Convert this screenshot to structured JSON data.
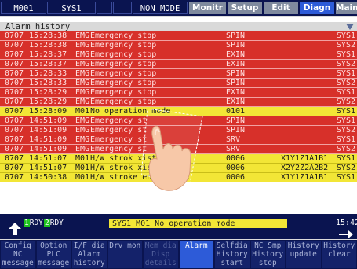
{
  "topbar": {
    "part": "M001",
    "system": "SYS1",
    "mode": "NON MODE",
    "tabs": [
      {
        "label": "Monitr",
        "active": false
      },
      {
        "label": "Setup",
        "active": false
      },
      {
        "label": "Edit",
        "active": false
      },
      {
        "label": "Diagn",
        "active": true
      },
      {
        "label": "Mainte",
        "active": false
      }
    ]
  },
  "alarm_history": {
    "title": "Alarm history",
    "rows": [
      {
        "date": "0707",
        "time": "15:28:38",
        "type": "EMG",
        "message": "Emergency stop",
        "code": "SPIN",
        "axis": "",
        "system": "SYS1",
        "color": "red"
      },
      {
        "date": "0707",
        "time": "15:28:38",
        "type": "EMG",
        "message": "Emergency stop",
        "code": "SPIN",
        "axis": "",
        "system": "SYS2",
        "color": "red"
      },
      {
        "date": "0707",
        "time": "15:28:37",
        "type": "EMG",
        "message": "Emergency stop",
        "code": "EXIN",
        "axis": "",
        "system": "SYS1",
        "color": "red"
      },
      {
        "date": "0707",
        "time": "15:28:37",
        "type": "EMG",
        "message": "Emergency stop",
        "code": "EXIN",
        "axis": "",
        "system": "SYS2",
        "color": "red"
      },
      {
        "date": "0707",
        "time": "15:28:33",
        "type": "EMG",
        "message": "Emergency stop",
        "code": "SPIN",
        "axis": "",
        "system": "SYS1",
        "color": "red"
      },
      {
        "date": "0707",
        "time": "15:28:33",
        "type": "EMG",
        "message": "Emergency stop",
        "code": "SPIN",
        "axis": "",
        "system": "SYS2",
        "color": "red"
      },
      {
        "date": "0707",
        "time": "15:28:29",
        "type": "EMG",
        "message": "Emergency stop",
        "code": "EXIN",
        "axis": "",
        "system": "SYS1",
        "color": "red"
      },
      {
        "date": "0707",
        "time": "15:28:29",
        "type": "EMG",
        "message": "Emergency stop",
        "code": "EXIN",
        "axis": "",
        "system": "SYS2",
        "color": "red"
      },
      {
        "date": "0707",
        "time": "15:28:09",
        "type": "M01",
        "message": "No operation mode",
        "code": "0101",
        "axis": "",
        "system": "SYS1",
        "color": "yellow"
      },
      {
        "date": "0707",
        "time": "14:51:09",
        "type": "EMG",
        "message": "Emergency st",
        "code": "SPIN",
        "axis": "",
        "system": "SYS1",
        "color": "red"
      },
      {
        "date": "0707",
        "time": "14:51:09",
        "type": "EMG",
        "message": "Emergency st",
        "code": "SPIN",
        "axis": "",
        "system": "SYS2",
        "color": "red"
      },
      {
        "date": "0707",
        "time": "14:51:09",
        "type": "EMG",
        "message": "Emergency st",
        "code": "SRV",
        "axis": "",
        "system": "SYS1",
        "color": "red"
      },
      {
        "date": "0707",
        "time": "14:51:09",
        "type": "EMG",
        "message": "Emergency st",
        "code": "SRV",
        "axis": "",
        "system": "SYS2",
        "color": "red"
      },
      {
        "date": "0707",
        "time": "14:51:07",
        "type": "M01",
        "message": "H/W strok        xists",
        "code": "0006",
        "axis": "X1Y1Z1A1B1",
        "system": "SYS1",
        "color": "yellow"
      },
      {
        "date": "0707",
        "time": "14:51:07",
        "type": "M01",
        "message": "H/W strok        xists",
        "code": "0006",
        "axis": "X2Y2Z2A2B2",
        "system": "SYS2",
        "color": "yellow"
      },
      {
        "date": "0707",
        "time": "14:50:38",
        "type": "M01",
        "message": "H/W stroke end    exists",
        "code": "0006",
        "axis": "X1Y1Z1A1B1",
        "system": "SYS1",
        "color": "yellow"
      }
    ]
  },
  "statusbar": {
    "rdy1_num": "1",
    "rdy1_label": "RDY",
    "rdy2_num": "2",
    "rdy2_label": "RDY",
    "message": "SYS1 M01  No operation mode",
    "clock": "15:42"
  },
  "function_keys": [
    {
      "top": "Config",
      "bottom": "NC",
      "third": "message",
      "state": "normal"
    },
    {
      "top": "Option",
      "bottom": "PLC",
      "third": "message",
      "state": "normal"
    },
    {
      "top": "I/F dia",
      "bottom": "Alarm",
      "third": "history",
      "state": "normal"
    },
    {
      "top": "Drv mon",
      "bottom": "",
      "third": "",
      "state": "normal"
    },
    {
      "top": "Mem dia",
      "bottom": "Disp",
      "third": "details",
      "state": "normal"
    },
    {
      "top": "Alarm",
      "bottom": "",
      "third": "",
      "state": "on"
    },
    {
      "top": "Selfdia",
      "bottom": "History",
      "third": "start",
      "state": "normal"
    },
    {
      "top": "NC Smp",
      "bottom": "History",
      "third": "stop",
      "state": "normal"
    },
    {
      "top": "",
      "bottom": "History",
      "third": "update",
      "state": "normal"
    },
    {
      "top": "",
      "bottom": "History",
      "third": "clear",
      "state": "normal"
    }
  ]
}
